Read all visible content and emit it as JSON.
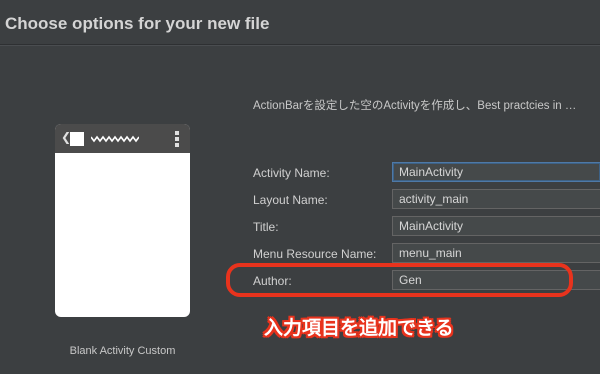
{
  "dialog": {
    "title": "Choose options for your new file",
    "description": "ActionBarを設定した空のActivityを作成し、Best practcies in …"
  },
  "preview": {
    "back_glyph": "❮",
    "template_name": "Blank Activity Custom"
  },
  "form": {
    "fields": [
      {
        "label": "Activity Name:",
        "value": "MainActivity"
      },
      {
        "label": "Layout Name:",
        "value": "activity_main"
      },
      {
        "label": "Title:",
        "value": "MainActivity"
      },
      {
        "label": "Menu Resource Name:",
        "value": "menu_main"
      },
      {
        "label": "Author:",
        "value": "Gen"
      }
    ]
  },
  "annotation": {
    "text": "入力項目を追加できる",
    "color": "#e8331d"
  },
  "colors": {
    "background": "#3c3f41",
    "input_background": "#45494a",
    "focus_border": "#4e79a7",
    "highlight": "#e8331d"
  }
}
